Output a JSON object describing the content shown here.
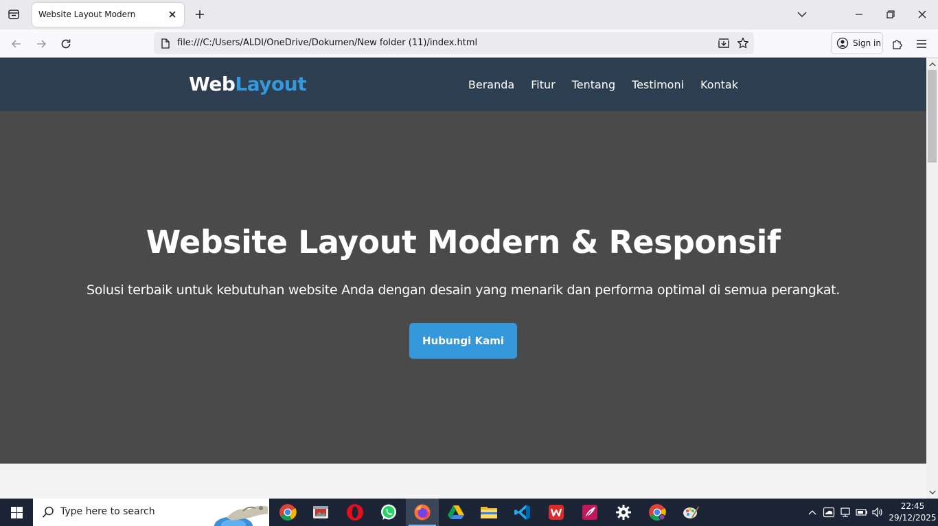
{
  "browser": {
    "tab_title": "Website Layout Modern",
    "url": "file:///C:/Users/ALDI/OneDrive/Dokumen/New folder (11)/index.html",
    "sign_in_label": "Sign in"
  },
  "site": {
    "logo_part1": "Web",
    "logo_part2": "Layout",
    "nav": [
      "Beranda",
      "Fitur",
      "Tentang",
      "Testimoni",
      "Kontak"
    ],
    "hero_title": "Website Layout Modern & Responsif",
    "hero_subtitle": "Solusi terbaik untuk kebutuhan website Anda dengan desain yang menarik dan performa optimal di semua perangkat.",
    "hero_button": "Hubungi Kami"
  },
  "taskbar": {
    "search_placeholder": "Type here to search",
    "clock_time": "22:45",
    "clock_date": "29/12/2025"
  },
  "colors": {
    "nav_bg": "#2c3e50",
    "accent": "#3498db",
    "hero_bg": "#4a4a4a",
    "taskbar_bg": "#1b2535"
  }
}
